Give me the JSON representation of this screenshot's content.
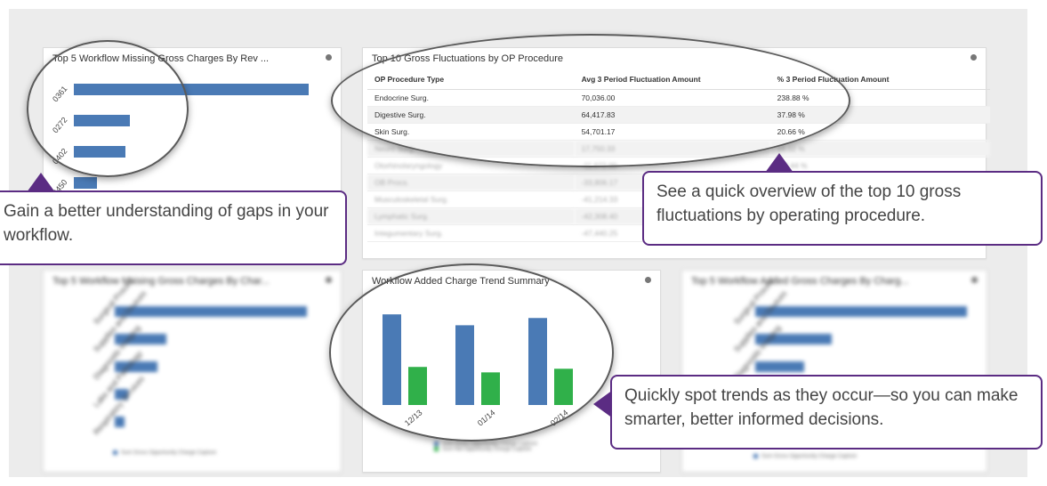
{
  "panels": {
    "missing_rev": {
      "title": "Top 5 Workflow Missing Gross Charges By Rev ...",
      "ticks": [
        "0361",
        "0272",
        "0402",
        "0450"
      ],
      "values": [
        100,
        24,
        22,
        10
      ]
    },
    "fluctuations": {
      "title": "Top 10 Gross Fluctuations by OP Procedure",
      "columns": [
        "OP Procedure Type",
        "Avg 3 Period Fluctuation Amount",
        "% 3 Period Fluctuation Amount"
      ],
      "rows": [
        [
          "Endocrine Surg.",
          "70,036.00",
          "238.88 %"
        ],
        [
          "Digestive Surg.",
          "64,417.83",
          "37.98 %"
        ],
        [
          "Skin Surg.",
          "54,701.17",
          "20.66 %"
        ],
        [
          "Neuro Surg.",
          "17,750.33",
          "16.02 %"
        ],
        [
          "Otorhinolaryngology",
          "-11,672.00",
          "-12.44 %"
        ],
        [
          "OB Procs.",
          "-33,806.17",
          "-25.58 %"
        ],
        [
          "Musculoskeletal Surg.",
          "-41,214.33",
          "-31.14 %"
        ],
        [
          "Lymphatic Surg.",
          "-42,308.40",
          "-35.70 %"
        ],
        [
          "Integumentary Surg.",
          "-47,440.25",
          "-39.92 %"
        ]
      ]
    },
    "missing_charge": {
      "title": "Top 5 Workflow Missing Gross Charges By Char...",
      "ticks": [
        "Surgical Proced...",
        "Supplies and Devices",
        "Diagnostic Imaging",
        "Labs and Pathology",
        "Respiratory Services"
      ],
      "values": [
        100,
        27,
        22,
        7,
        5
      ],
      "legend": "Sum Gross Opportunity Charge Capture"
    },
    "trend": {
      "title": "Workflow Added Charge Trend Summary",
      "ticks": [
        "12/13",
        "01/14",
        "02/14"
      ],
      "legend": [
        "Sum Gross Opportunity Charge Capture",
        "Sum Net Opportunity Charge Capture"
      ]
    },
    "added_charge": {
      "title": "Top 5 Workflow Added Gross Charges By Charg...",
      "ticks": [
        "Surgical Proced...",
        "Supplies and Devices",
        "Diagnostic Imaging"
      ],
      "values": [
        100,
        36,
        23
      ],
      "legend": "Sum Gross Opportunity Charge Capture"
    }
  },
  "chart_data": {
    "type": "bar",
    "title": "Workflow Added Charge Trend Summary",
    "categories": [
      "12/13",
      "01/14",
      "02/14"
    ],
    "series": [
      {
        "name": "Sum Gross Opportunity Charge Capture",
        "values": [
          100,
          88,
          96
        ]
      },
      {
        "name": "Sum Net Opportunity Charge Capture",
        "values": [
          42,
          36,
          40
        ]
      }
    ],
    "ylim": [
      0,
      110
    ]
  },
  "callouts": {
    "gaps": "Gain a better understanding of gaps in your workflow.",
    "overview": "See a quick overview of the top 10 gross fluctuations by operating procedure.",
    "trends": "Quickly spot trends as they occur—so you can make smarter, better informed decisions."
  },
  "colors": {
    "bar_blue": "#4a7ab5",
    "bar_green": "#30b04a",
    "callout_border": "#5b2c83"
  }
}
